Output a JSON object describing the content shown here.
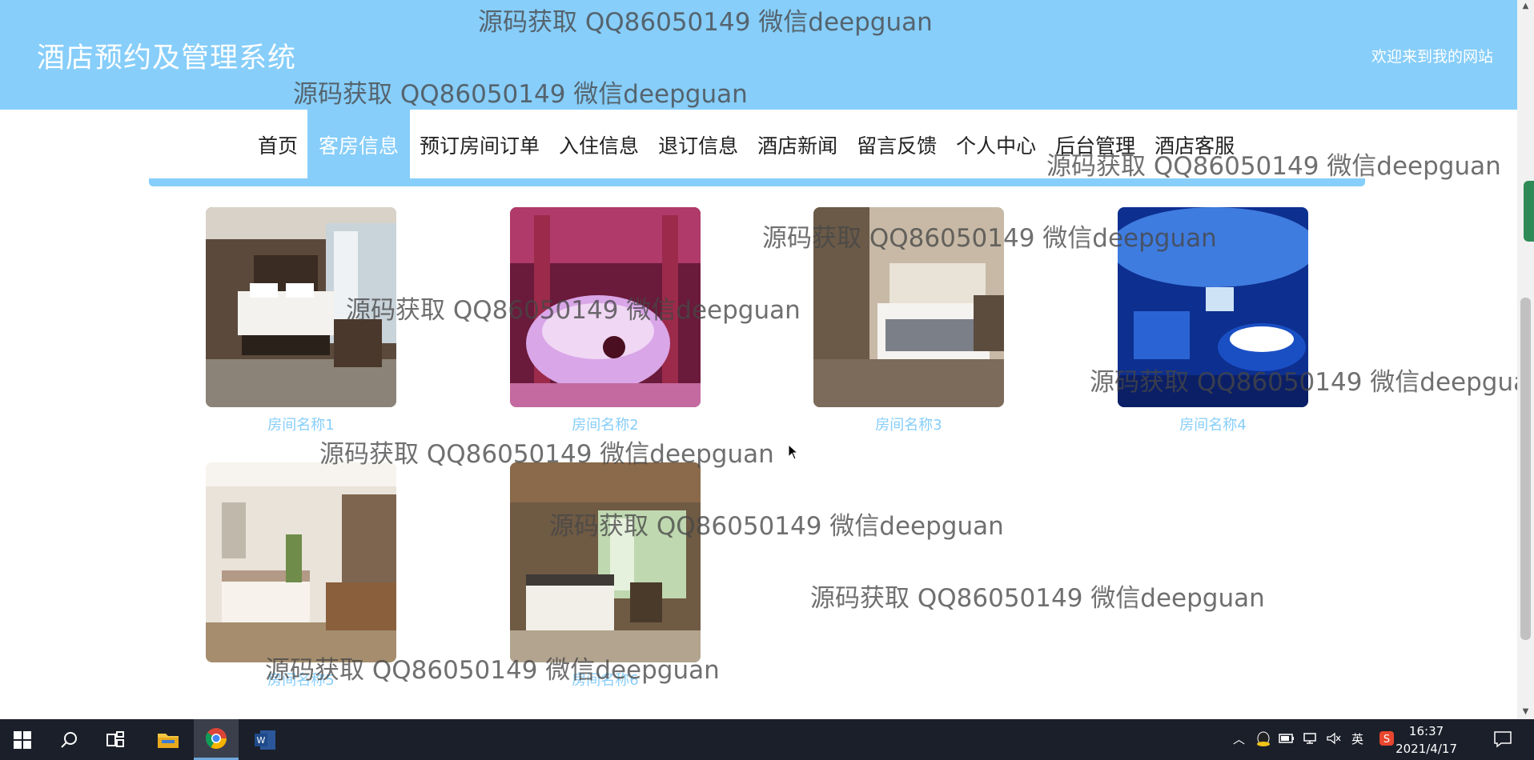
{
  "header": {
    "title": "酒店预约及管理系统",
    "welcome": "欢迎来到我的网站"
  },
  "nav": {
    "items": [
      "首页",
      "客房信息",
      "预订房间订单",
      "入住信息",
      "退订信息",
      "酒店新闻",
      "留言反馈",
      "个人中心",
      "后台管理",
      "酒店客服"
    ],
    "active_index": 1
  },
  "rooms": [
    {
      "name": "房间名称1"
    },
    {
      "name": "房间名称2"
    },
    {
      "name": "房间名称3"
    },
    {
      "name": "房间名称4"
    },
    {
      "name": "房间名称5"
    },
    {
      "name": "房间名称6"
    }
  ],
  "watermark": "源码获取 QQ86050149 微信deepguan",
  "taskbar": {
    "icons": [
      "windows-start-icon",
      "search-icon",
      "task-view-icon",
      "file-explorer-icon",
      "chrome-icon",
      "word-icon"
    ],
    "tray": {
      "ime": "英",
      "time": "16:37",
      "date": "2021/4/17"
    }
  },
  "colors": {
    "accent": "#87cefa",
    "taskbar": "#1b1f2a"
  }
}
